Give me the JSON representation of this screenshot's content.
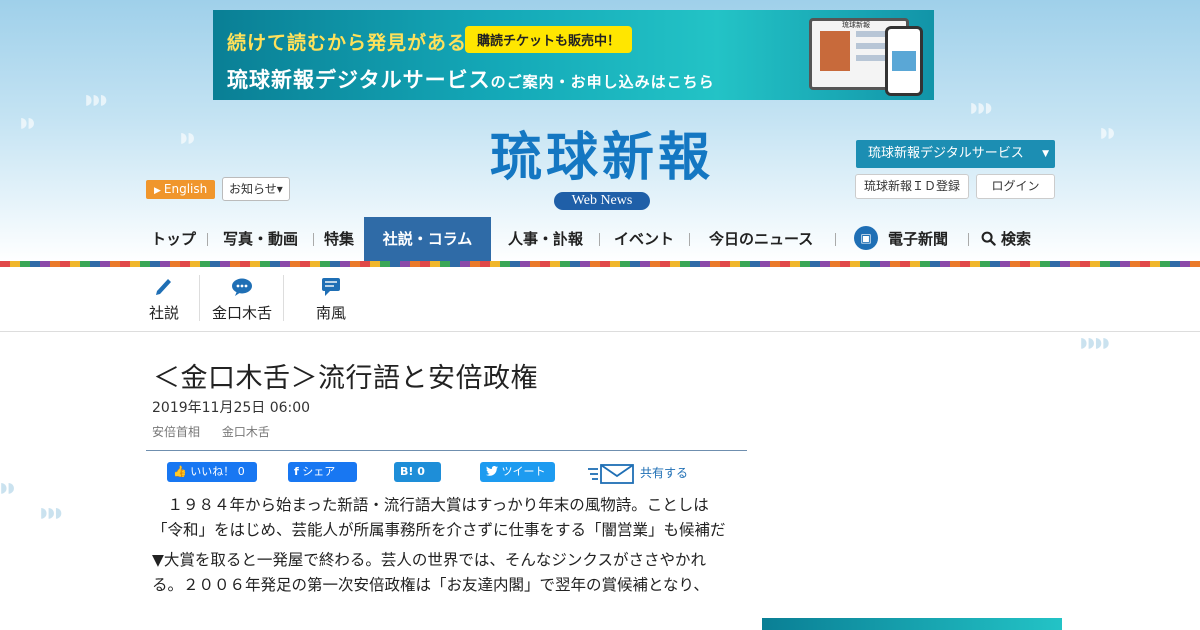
{
  "banner": {
    "line1": "続けて読むから発見がある",
    "pill": "購読チケットも販売中！",
    "line2_a": "琉球新報デジタルサービス",
    "line2_b": "のご案内・お申し込み",
    "line2_c": "はこちら",
    "device_label": "琉球新報"
  },
  "header": {
    "logo_text": "琉球新報",
    "logo_sub": "Web News",
    "english_label": "English",
    "notice_label": "お知らせ▾",
    "digital_service_label": "琉球新報デジタルサービス",
    "id_register_label": "琉球新報ＩＤ登録",
    "login_label": "ログイン"
  },
  "nav": {
    "items": [
      "トップ",
      "写真・動画",
      "特集",
      "社説・コラム",
      "人事・訃報",
      "イベント",
      "今日のニュース",
      "電子新聞",
      "検索"
    ]
  },
  "subnav": {
    "items": [
      "社説",
      "金口木舌",
      "南風"
    ]
  },
  "article": {
    "title": "＜金口木舌＞流行語と安倍政権",
    "date": "2019年11月25日 06:00",
    "tags": [
      "安倍首相",
      "金口木舌"
    ],
    "paragraphs": [
      "　１９８４年から始まった新語・流行語大賞はすっかり年末の風物詩。ことしは「令和」をはじめ、芸能人が所属事務所を介さずに仕事をする「闇営業」も候補だ",
      "▼大賞を取ると一発屋で終わる。芸人の世界では、そんなジンクスがささやかれる。２００６年発足の第一次安倍政権は「お友達内閣」で翌年の賞候補となり、"
    ]
  },
  "share": {
    "fb_like": "いいね！ 0",
    "fb_share": "シェア",
    "hatena": "B! 0",
    "tweet": "ツイート",
    "mail": "共有する"
  },
  "colors": {
    "brand_blue": "#1477c2",
    "nav_active": "#2f6ba7",
    "english_orange": "#f0962c",
    "digital_teal": "#1c8eb3"
  }
}
